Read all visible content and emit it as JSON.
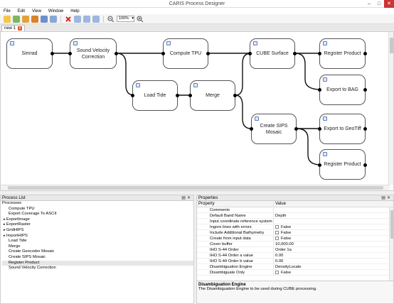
{
  "app": {
    "title": "CARIS Process Designer"
  },
  "menu": [
    "File",
    "Edit",
    "View",
    "Window",
    "Help"
  ],
  "toolbar": {
    "zoom": "100%",
    "icons": [
      "new-icon",
      "open-icon",
      "open-folder-icon",
      "open-template-icon",
      "save-icon",
      "save-as-icon",
      "delete-icon",
      "cut-icon",
      "link-icon",
      "layout-icon",
      "zoom-out-icon",
      "zoom-in-icon"
    ]
  },
  "tabs": [
    {
      "label": "new 1"
    }
  ],
  "canvas": {
    "nodes": {
      "simrad": "Simrad",
      "sound_velocity": "Sound Velocity Correction",
      "compute_tpu": "Compute TPU",
      "cube_surface": "CUBE Surface",
      "register_product_1": "Register Product",
      "export_bag": "Export to BAG",
      "load_tide": "Load Tide",
      "merge": "Merge",
      "create_sips": "Create SIPS Mosaic",
      "export_geotiff": "Export to GeoTiff",
      "register_product_2": "Register Product"
    }
  },
  "process_list": {
    "title": "Process List",
    "header": "Processes",
    "items": [
      {
        "label": "Compute TPU",
        "expandable": false
      },
      {
        "label": "Export Coverage To ASCII",
        "expandable": false
      },
      {
        "label": "ExportImage",
        "expandable": true
      },
      {
        "label": "ExportRaster",
        "expandable": true
      },
      {
        "label": "GridHIPS",
        "expandable": true
      },
      {
        "label": "ImportHIPS",
        "expandable": true
      },
      {
        "label": "Load Tide",
        "expandable": false
      },
      {
        "label": "Merge",
        "expandable": false
      },
      {
        "label": "Create Geocoder Mosaic",
        "expandable": false
      },
      {
        "label": "Create SIPS Mosaic",
        "expandable": false
      },
      {
        "label": "Register Product",
        "expandable": false,
        "selected": true
      },
      {
        "label": "Sound Velocity Correction",
        "expandable": false
      }
    ]
  },
  "properties": {
    "title": "Properties",
    "col_property": "Property",
    "col_value": "Value",
    "rows": [
      {
        "name": "Comments",
        "value": "",
        "checkbox": false
      },
      {
        "name": "Default Band Name",
        "value": "Depth",
        "checkbox": false
      },
      {
        "name": "Input coordinate reference system",
        "value": "",
        "checkbox": false
      },
      {
        "name": "Ingore lines with errors",
        "value": "False",
        "checkbox": true
      },
      {
        "name": "Include Additional Bathymetry",
        "value": "False",
        "checkbox": true
      },
      {
        "name": "Create from input data",
        "value": "False",
        "checkbox": true
      },
      {
        "name": "Cover buffer",
        "value": "10,000.00",
        "checkbox": false
      },
      {
        "name": "IHO S-44 Order",
        "value": "Order 1a",
        "checkbox": false
      },
      {
        "name": "IHO S-44 Order a value",
        "value": "0.00",
        "checkbox": false
      },
      {
        "name": "IHO S-44 Order b value",
        "value": "0.00",
        "checkbox": false
      },
      {
        "name": "Disambiguation Engine",
        "value": "DensityLocale",
        "checkbox": false
      },
      {
        "name": "Disambiguate Only",
        "value": "False",
        "checkbox": true
      }
    ],
    "description_title": "Disambiguation Engine",
    "description_text": "The Disambiguation Engine to be used during CUBE processing."
  }
}
